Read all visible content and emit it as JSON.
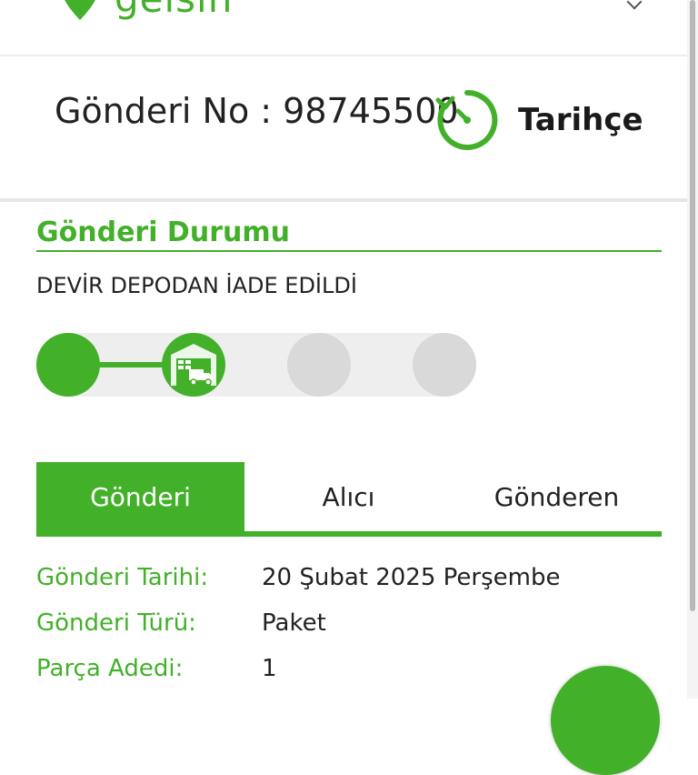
{
  "header": {
    "logo_text": "gelsin",
    "logo_icon": "location-pin-icon"
  },
  "tracking": {
    "shipment_number_text": "Gönderi No : 98745500",
    "history_label": "Tarihçe",
    "history_icon": "history-clock-icon"
  },
  "status_section": {
    "title": "Gönderi Durumu",
    "status_text": "DEVİR DEPODAN İADE EDİLDİ",
    "progress": {
      "total_steps": 4,
      "current_step": 2,
      "steps": [
        {
          "state": "done"
        },
        {
          "state": "current",
          "icon": "warehouse-truck-icon"
        },
        {
          "state": "pending"
        },
        {
          "state": "pending"
        }
      ]
    }
  },
  "tabs": [
    {
      "label": "Gönderi",
      "active": true
    },
    {
      "label": "Alıcı",
      "active": false
    },
    {
      "label": "Gönderen",
      "active": false
    }
  ],
  "details": [
    {
      "label": "Gönderi Tarihi:",
      "value": "20 Şubat 2025 Perşembe"
    },
    {
      "label": "Gönderi Türü:",
      "value": "Paket"
    },
    {
      "label": "Parça Adedi:",
      "value": "1"
    }
  ],
  "colors": {
    "accent": "#43b02a",
    "inactive_step": "#d9d9d9",
    "track": "#eeeeee"
  }
}
